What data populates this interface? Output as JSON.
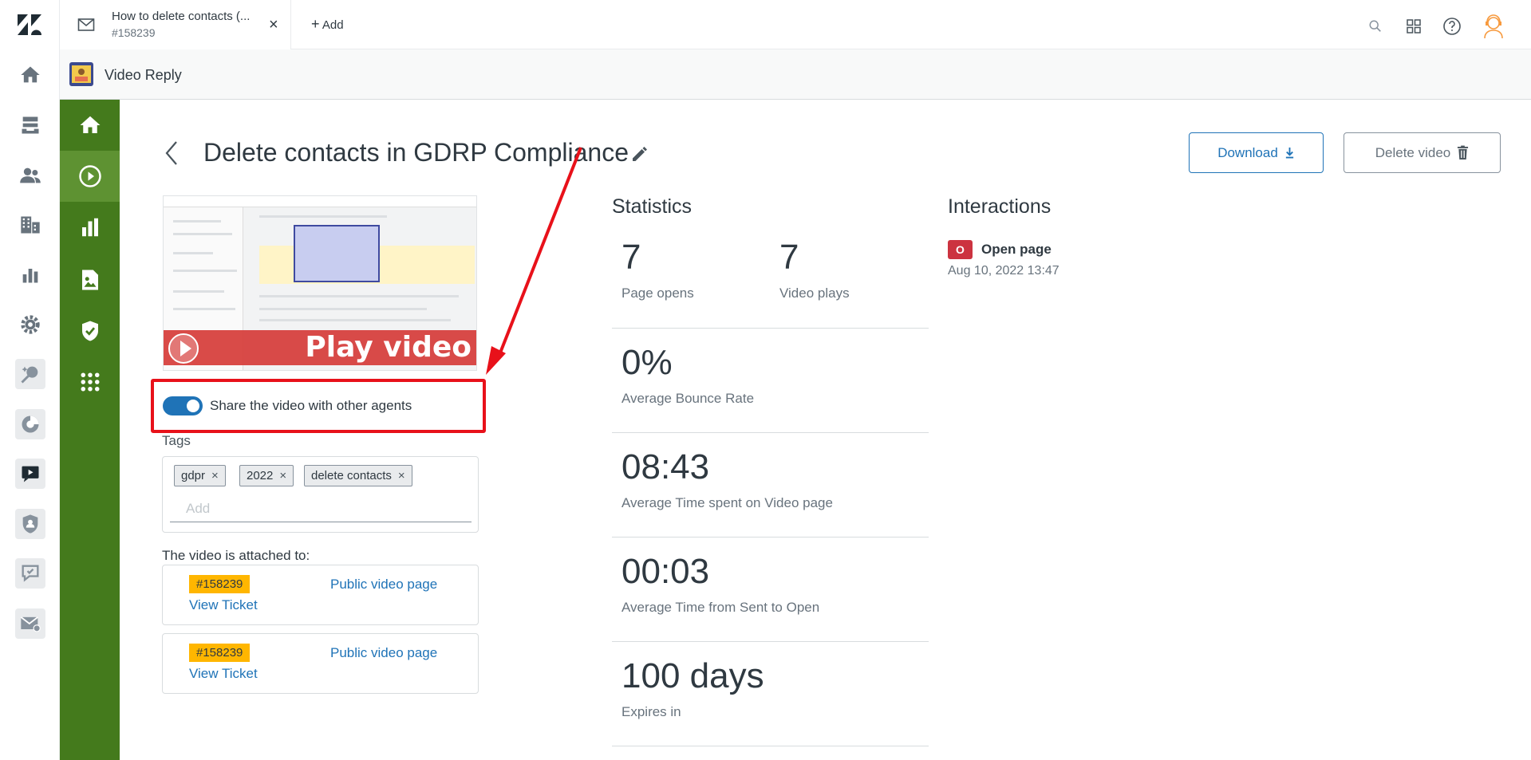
{
  "colors": {
    "accent": "#1f73b7",
    "nav_green": "#447a1c",
    "nav_green_active": "#5e9232",
    "badge_yellow": "#ffb600",
    "annotation_red": "#e8111a",
    "interaction_red": "#cc3340"
  },
  "rail": {
    "items": [
      {
        "icon": "home-icon"
      },
      {
        "icon": "views-icon"
      },
      {
        "icon": "customers-icon"
      },
      {
        "icon": "organizations-icon"
      },
      {
        "icon": "reporting-icon"
      },
      {
        "icon": "admin-gear-icon"
      },
      {
        "icon": "app-sparkle-icon"
      },
      {
        "icon": "app-chart-icon"
      },
      {
        "icon": "app-video-reply-icon"
      },
      {
        "icon": "app-shield-user-icon"
      },
      {
        "icon": "app-chat-icon"
      },
      {
        "icon": "app-mail-icon"
      }
    ]
  },
  "topbar": {
    "tab": {
      "title": "How to delete contacts (...",
      "ticket": "#158239"
    },
    "add_label": "Add",
    "icons": [
      "search-icon",
      "apps-grid-icon",
      "help-icon",
      "profile-avatar"
    ]
  },
  "appbar": {
    "name": "Video Reply"
  },
  "app_nav": {
    "items": [
      "home-icon",
      "play-icon",
      "stats-icon",
      "image-icon",
      "shield-check-icon",
      "apps-icon"
    ],
    "active_index": 1
  },
  "page": {
    "title": "Delete contacts in GDRP Compliance",
    "download_label": "Download",
    "delete_label": "Delete video",
    "play_label": "Play video",
    "share_label": "Share the video with other agents",
    "share_enabled": true,
    "tags_label": "Tags",
    "tags": [
      {
        "label": "gdpr"
      },
      {
        "label": "2022"
      },
      {
        "label": "delete contacts"
      }
    ],
    "tags_placeholder": "Add",
    "attached_label": "The video is attached to:",
    "attachments": [
      {
        "ticket": "#158239",
        "view_label": "View Ticket",
        "public_label": "Public video page"
      },
      {
        "ticket": "#158239",
        "view_label": "View Ticket",
        "public_label": "Public video page"
      }
    ]
  },
  "statistics": {
    "title": "Statistics",
    "page_opens": {
      "value": "7",
      "label": "Page opens"
    },
    "video_plays": {
      "value": "7",
      "label": "Video plays"
    },
    "bounce": {
      "value": "0%",
      "label": "Average Bounce Rate"
    },
    "time_spent": {
      "value": "08:43",
      "label": "Average Time spent on Video page"
    },
    "sent_to_open": {
      "value": "00:03",
      "label": "Average Time from Sent to Open"
    },
    "expires": {
      "value": "100 days",
      "label": "Expires in"
    }
  },
  "interactions": {
    "title": "Interactions",
    "items": [
      {
        "badge": "O",
        "name": "Open page",
        "date": "Aug 10, 2022 13:47"
      }
    ]
  }
}
